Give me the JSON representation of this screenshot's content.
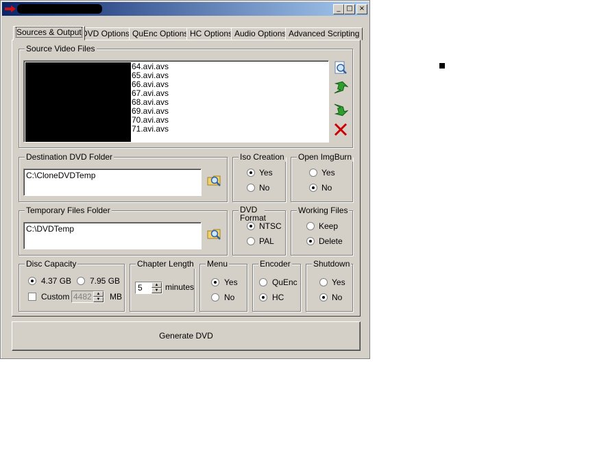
{
  "window": {
    "minimize": "_",
    "maximize": "□",
    "close": "×"
  },
  "tabs": [
    {
      "label": "Sources & Output",
      "active": true
    },
    {
      "label": "DVD Options"
    },
    {
      "label": "QuEnc Options"
    },
    {
      "label": "HC Options"
    },
    {
      "label": "Audio Options"
    },
    {
      "label": "Advanced Scripting"
    }
  ],
  "source": {
    "label": "Source Video Files",
    "files": [
      "64.avi.avs",
      "65.avi.avs",
      "66.avi.avs",
      "67.avi.avs",
      "68.avi.avs",
      "69.avi.avs",
      "70.avi.avs",
      "71.avi.avs"
    ]
  },
  "destination": {
    "label": "Destination DVD Folder",
    "value": "C:\\CloneDVDTemp"
  },
  "temporary": {
    "label": "Temporary Files Folder",
    "value": "C:\\DVDTemp"
  },
  "iso": {
    "label": "Iso Creation",
    "yes": "Yes",
    "no": "No"
  },
  "imgburn": {
    "label": "Open ImgBurn",
    "yes": "Yes",
    "no": "No"
  },
  "dvdformat": {
    "label": "DVD Format",
    "ntsc": "NTSC",
    "pal": "PAL"
  },
  "working": {
    "label": "Working Files",
    "keep": "Keep",
    "delete": "Delete"
  },
  "capacity": {
    "label": "Disc Capacity",
    "opt1": "4.37 GB",
    "opt2": "7.95 GB",
    "custom": "Custom",
    "custom_value": "4482",
    "unit": "MB"
  },
  "chapter": {
    "label": "Chapter Length",
    "value": "5",
    "unit": "minutes"
  },
  "menu": {
    "label": "Menu",
    "yes": "Yes",
    "no": "No"
  },
  "encoder": {
    "label": "Encoder",
    "quenc": "QuEnc",
    "hc": "HC"
  },
  "shutdown": {
    "label": "Shutdown",
    "yes": "Yes",
    "no": "No"
  },
  "generate": {
    "label": "Generate DVD"
  },
  "icons": {
    "add": "add-file-icon",
    "up": "move-up-icon",
    "down": "move-down-icon",
    "remove": "remove-icon",
    "browse": "browse-folder-icon"
  },
  "colors": {
    "titlebar_start": "#0a246a",
    "titlebar_end": "#a6caf0",
    "face": "#d4d0c8",
    "remove": "#cc0000",
    "arrow": "#2e9e2e"
  }
}
